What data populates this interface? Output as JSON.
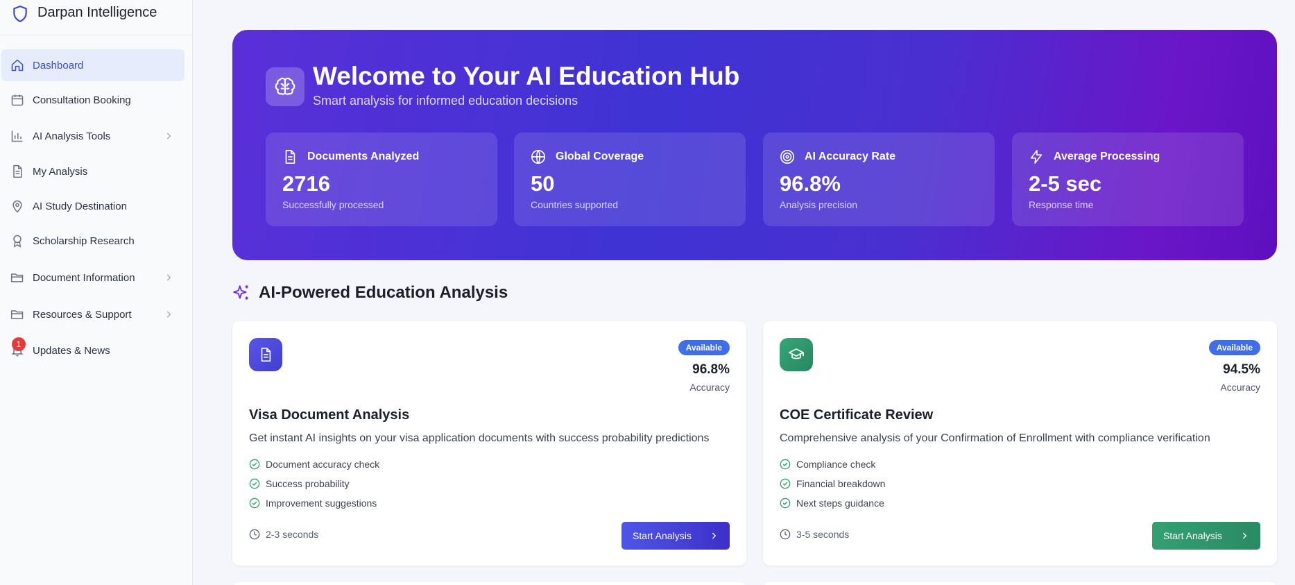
{
  "brand": {
    "name": "Darpan Intelligence",
    "icon": "shield-icon"
  },
  "sidebar": {
    "items": [
      {
        "label": "Dashboard",
        "icon": "home-icon",
        "active": true
      },
      {
        "label": "Consultation Booking",
        "icon": "calendar-icon"
      },
      {
        "label": "AI Analysis Tools",
        "icon": "bar-chart-icon",
        "expandable": true
      },
      {
        "label": "My Analysis",
        "icon": "document-icon"
      },
      {
        "label": "AI Study Destination",
        "icon": "map-pin-icon"
      },
      {
        "label": "Scholarship Research",
        "icon": "award-icon"
      },
      {
        "label": "Document Information",
        "icon": "folder-icon",
        "expandable": true
      },
      {
        "label": "Resources & Support",
        "icon": "folder-icon",
        "expandable": true
      },
      {
        "label": "Updates & News",
        "icon": "bell-icon",
        "badge": "1"
      }
    ]
  },
  "hero": {
    "icon": "brain-icon",
    "title": "Welcome to Your AI Education Hub",
    "subtitle": "Smart analysis for informed education decisions",
    "stats": [
      {
        "icon": "document-icon",
        "label": "Documents Analyzed",
        "value": "2716",
        "desc": "Successfully processed"
      },
      {
        "icon": "globe-icon",
        "label": "Global Coverage",
        "value": "50",
        "desc": "Countries supported"
      },
      {
        "icon": "target-icon",
        "label": "AI Accuracy Rate",
        "value": "96.8%",
        "desc": "Analysis precision"
      },
      {
        "icon": "lightning-icon",
        "label": "Average Processing",
        "value": "2-5 sec",
        "desc": "Response time"
      }
    ]
  },
  "section": {
    "title": "AI-Powered Education Analysis",
    "icon": "sparkles-icon"
  },
  "cards": [
    {
      "icon": "document-icon",
      "badge": "Available",
      "accuracy": "96.8%",
      "accuracy_label": "Accuracy",
      "title": "Visa Document Analysis",
      "description": "Get instant AI insights on your visa application documents with success probability predictions",
      "features": [
        "Document accuracy check",
        "Success probability",
        "Improvement suggestions"
      ],
      "time": "2-3 seconds",
      "button": "Start Analysis",
      "accent": "#4a4fe0"
    },
    {
      "icon": "graduation-cap-icon",
      "badge": "Available",
      "accuracy": "94.5%",
      "accuracy_label": "Accuracy",
      "title": "COE Certificate Review",
      "description": "Comprehensive analysis of your Confirmation of Enrollment with compliance verification",
      "features": [
        "Compliance check",
        "Financial breakdown",
        "Next steps guidance"
      ],
      "time": "3-5 seconds",
      "button": "Start Analysis",
      "accent": "#2f9a6e"
    }
  ],
  "colors": {
    "hero_start": "#5a2fd8",
    "hero_end": "#6a16c8",
    "active_nav": "#3b4ccf",
    "badge_blue": "#3f6ee8",
    "check_green": "#2fa36a",
    "notification_red": "#e33b3b"
  }
}
